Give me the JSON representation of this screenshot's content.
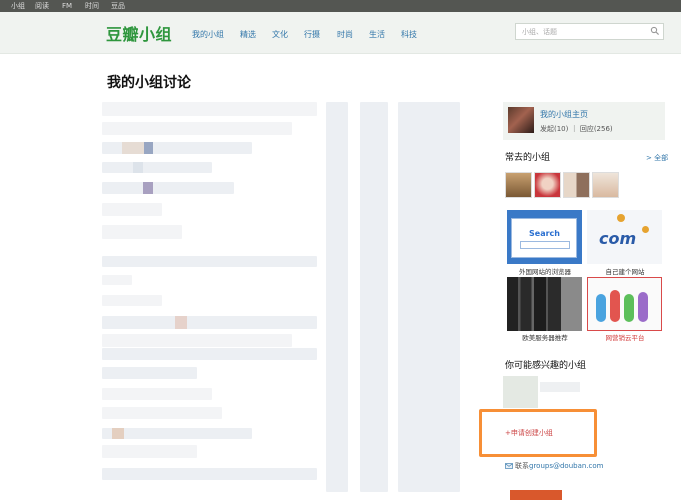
{
  "topbar": {
    "links": [
      "小组",
      "阅读",
      "FM",
      "时间",
      "豆品"
    ]
  },
  "header": {
    "logo": "豆瓣小组",
    "nav": [
      "我的小组",
      "精选",
      "文化",
      "行摄",
      "时尚",
      "生活",
      "科技"
    ],
    "search_placeholder": "小组、话题"
  },
  "page": {
    "title": "我的小组讨论"
  },
  "sidebar": {
    "profile": {
      "home_link": "我的小组主页",
      "stats": "发起(10) ｜ 回应(256)"
    },
    "frequent": {
      "title": "常去的小组",
      "more": "> 全部"
    },
    "ads": [
      {
        "caption": "外国网站的浏览器",
        "search_text": "Search"
      },
      {
        "caption": "自己建个网站",
        "logo_text": "com"
      },
      {
        "caption": "欧美服务器推荐"
      },
      {
        "caption": "网营销云平台"
      }
    ],
    "interest": {
      "title": "你可能感兴趣的小组"
    },
    "apply": "+申请创建小组",
    "contact_label": "联系",
    "contact_email": "groups@douban.com"
  },
  "colors": {
    "brand_green": "#2e963d",
    "link_blue": "#3377aa",
    "highlight_orange": "#f78f36"
  }
}
